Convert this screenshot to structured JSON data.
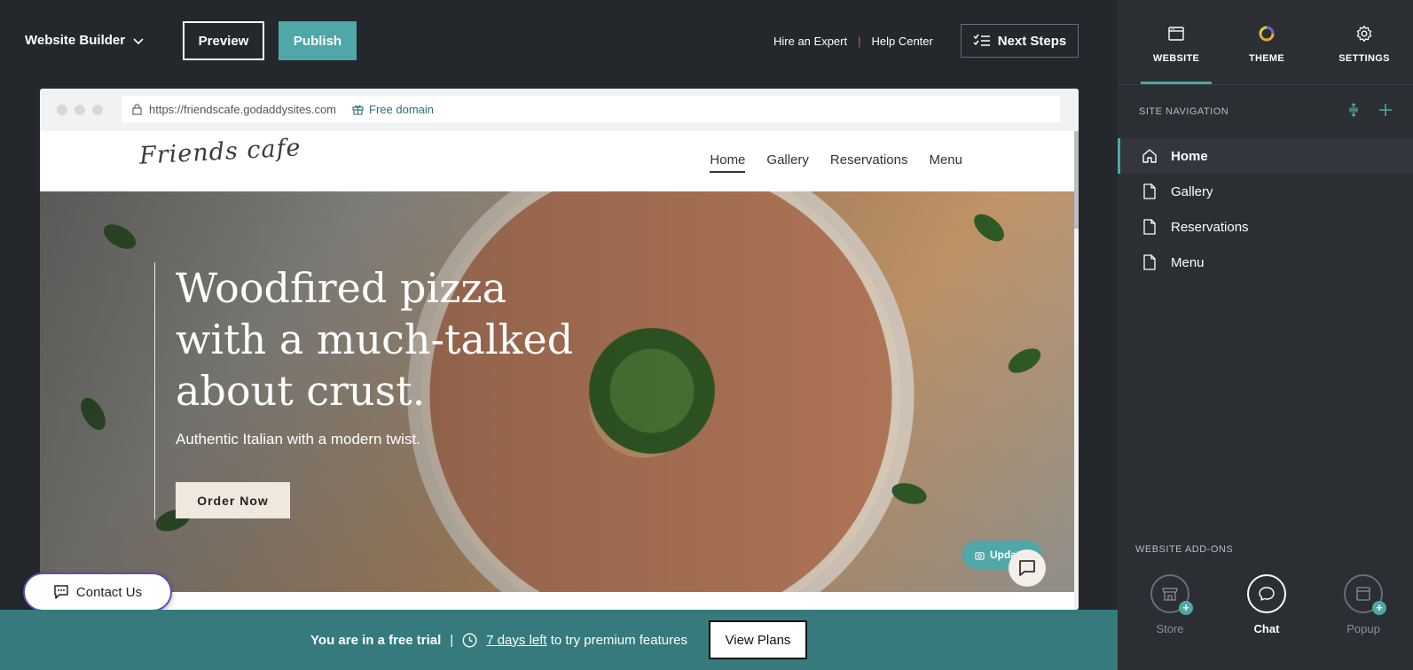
{
  "topbar": {
    "brand": "Website Builder",
    "preview_label": "Preview",
    "publish_label": "Publish",
    "hire_expert": "Hire an Expert",
    "link_sep": "|",
    "help_center": "Help Center",
    "next_steps": "Next Steps"
  },
  "browser": {
    "url": "https://friendscafe.godaddysites.com",
    "free_domain": "Free domain"
  },
  "site": {
    "logo": "Friends cafe",
    "nav": [
      "Home",
      "Gallery",
      "Reservations",
      "Menu"
    ],
    "hero_title_lines": [
      "Woodfired pizza",
      "with a much-talked",
      "about crust."
    ],
    "hero_subtitle": "Authentic Italian with a modern twist.",
    "order_button": "Order Now",
    "update_badge": "Update"
  },
  "contact_button": "Contact Us",
  "trial": {
    "text": "You are in a free trial",
    "sep": "|",
    "days_left": "7 days left",
    "suffix": "to try premium features",
    "view_plans": "View Plans"
  },
  "panel": {
    "tabs": [
      "WEBSITE",
      "THEME",
      "SETTINGS"
    ],
    "active_tab": "WEBSITE",
    "section_title": "SITE NAVIGATION",
    "nav_items": [
      "Home",
      "Gallery",
      "Reservations",
      "Menu"
    ],
    "active_nav": "Home",
    "addons_title": "WEBSITE ADD-ONS",
    "addons": [
      "Store",
      "Chat",
      "Popup"
    ]
  },
  "colors": {
    "teal_accent": "#4fa7a8",
    "trial_bar": "#367a7d",
    "dark_bg": "#24272c",
    "panel_bg": "#2b2e33",
    "contact_border": "#5b4fb5"
  }
}
